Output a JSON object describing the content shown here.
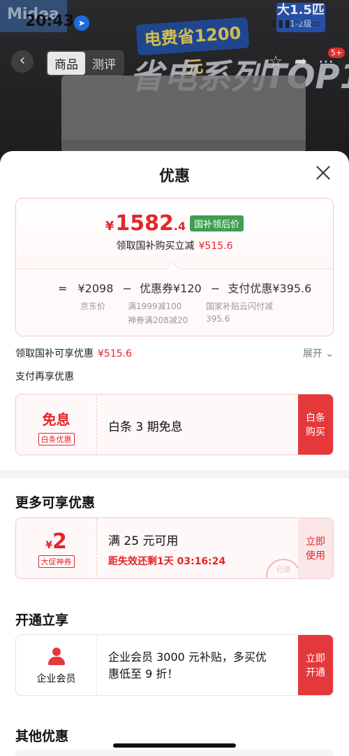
{
  "status": {
    "time": "20:43"
  },
  "background": {
    "logo": "Midea",
    "banner": "电费省1200元",
    "headline": "省电系列TOP1",
    "corner_tag": {
      "title": "大1.5匹",
      "subtitle": "1-2级"
    }
  },
  "nav": {
    "tabs": [
      "商品",
      "测评"
    ],
    "badge": "5+"
  },
  "sheet": {
    "title": "优惠",
    "price": {
      "currency": "¥",
      "integer": "1582",
      "decimal": ".4",
      "tag": "国补领后价",
      "subtitle": "领取国补购买立减",
      "subtitle_amount": "¥515.6",
      "breakdown": {
        "eq": "=",
        "jd_price": "¥2098",
        "op1": "−",
        "coupon": "优惠券¥120",
        "op2": "−",
        "payment": "支付优惠¥395.6",
        "jd_label": "京东价",
        "coupon_note1": "满1999减100",
        "coupon_note2": "神券满208减20",
        "payment_note1": "国家补贴云闪付减",
        "payment_note2": "395.6"
      }
    },
    "subsidy_row": {
      "label": "领取国补可享优惠",
      "amount": "¥515.6",
      "expand": "展开 ⌄"
    },
    "pay_section": "支付再享优惠",
    "baitiao": {
      "title": "免息",
      "tag": "白条优惠",
      "desc": "白条 3 期免息",
      "cta": "白条购买"
    },
    "more_section": "更多可享优惠",
    "promo_coupon": {
      "currency": "¥",
      "value": "2",
      "tag": "大促神券",
      "desc": "满 25 元可用",
      "countdown": "距失效还剩1天 03:16:24",
      "cta": "立即使用",
      "stamp": "已领"
    },
    "open_section": "开通立享",
    "enterprise": {
      "label": "企业会员",
      "desc_line1": "企业会员 3000 元补贴，多买优",
      "desc_line2": "惠低至 9 折！",
      "cta": "立即开通"
    },
    "other_section": "其他优惠"
  },
  "colors": {
    "accent": "#e4262a",
    "tag_green": "#3f9e52"
  }
}
